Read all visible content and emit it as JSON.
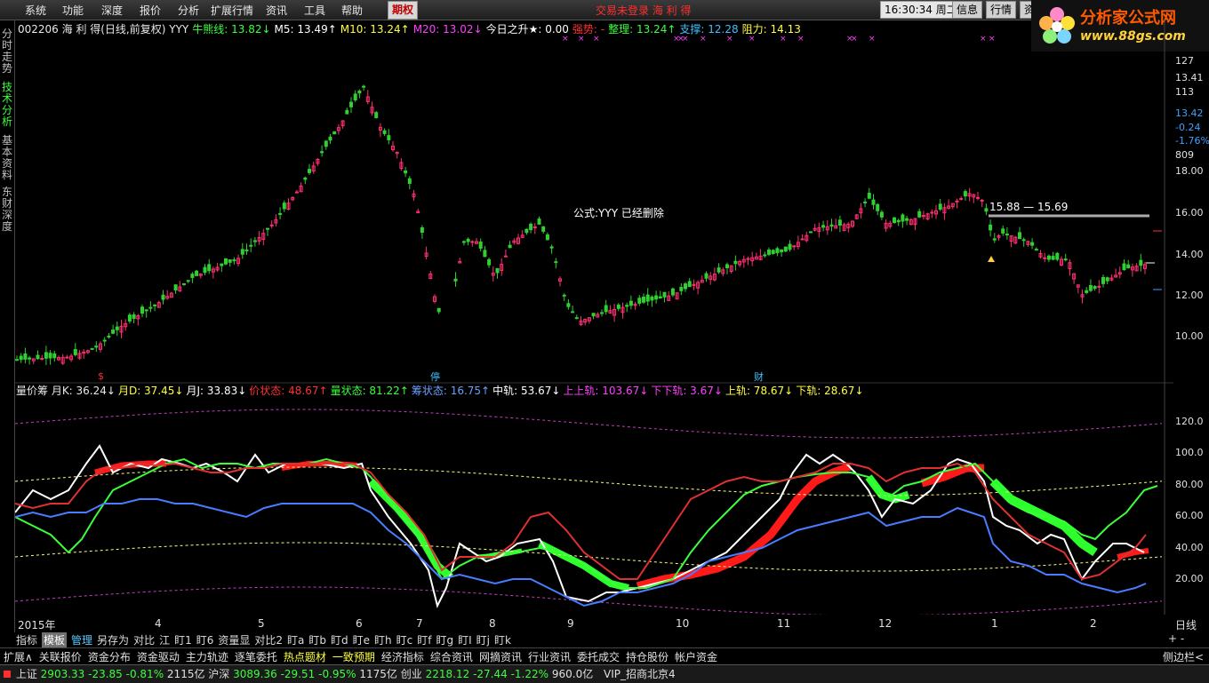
{
  "menu": {
    "items": [
      "系统",
      "功能",
      "深度",
      "报价",
      "分析",
      "扩展行情",
      "资讯",
      "工具",
      "帮助",
      "期权"
    ],
    "status_center": "交易未登录  海 利 得",
    "clock": "16:30:34",
    "weekday": "周二",
    "buttons": [
      "信息",
      "行情",
      "资"
    ]
  },
  "logo": {
    "text": "分析家公式网",
    "url": "www.88gs.com"
  },
  "leftnav": [
    "分时走势",
    "技术分析",
    "基本资料",
    "东财深度"
  ],
  "info_line": [
    {
      "t": "002206 海 利 得(日线,前复权) YYY",
      "c": "#e8e8e8"
    },
    {
      "t": "牛熊线: 13.82↓",
      "c": "#3cff3c"
    },
    {
      "t": "M5: 13.49↑",
      "c": "#ffffff"
    },
    {
      "t": "M10: 13.24↑",
      "c": "#ffff40"
    },
    {
      "t": "M20: 13.02↓",
      "c": "#ff40ff"
    },
    {
      "t": "今日之升★: 0.00",
      "c": "#ffffff"
    },
    {
      "t": "强势: -",
      "c": "#ff3030"
    },
    {
      "t": "整理: 13.24↑",
      "c": "#3cff3c"
    },
    {
      "t": "支撑: 12.28",
      "c": "#40c0ff"
    },
    {
      "t": "阻力: 14.13",
      "c": "#ffff40"
    }
  ],
  "deleted_msg": "公式:YYY 已经删除",
  "range_label": "15.88 — 15.69",
  "markers": {
    "s": "$",
    "ting": "停",
    "cai": "财"
  },
  "price_axis": {
    "labels": [
      "127",
      "13.41",
      "113",
      "13.42",
      "-0.24",
      "-1.76%",
      "809",
      "18.00",
      "16.00",
      "14.00",
      "12.00",
      "10.00"
    ],
    "colors": [
      "#e0e0e0",
      "#e0e0e0",
      "#e0e0e0",
      "#40a0ff",
      "#40a0ff",
      "#40a0ff",
      "#e0e0e0",
      "#e0e0e0",
      "#e0e0e0",
      "#e0e0e0",
      "#e0e0e0",
      "#e0e0e0"
    ]
  },
  "ind_axis": {
    "labels": [
      "120.0",
      "100.0",
      "80.00",
      "60.00",
      "40.00",
      "20.00"
    ]
  },
  "ind_line": [
    {
      "t": "量价筹 月K: 36.24↓",
      "c": "#e8e8e8"
    },
    {
      "t": "月D: 37.45↓",
      "c": "#ffff40"
    },
    {
      "t": "月J: 33.83↓",
      "c": "#ffffff"
    },
    {
      "t": "价状态: 48.67↑",
      "c": "#ff3030"
    },
    {
      "t": "量状态: 81.22↑",
      "c": "#3cff3c"
    },
    {
      "t": "筹状态: 16.75↑",
      "c": "#6aa0ff"
    },
    {
      "t": "中轨: 53.67↓",
      "c": "#ffffff"
    },
    {
      "t": "上上轨: 103.67↓",
      "c": "#ff40ff"
    },
    {
      "t": "下下轨: 3.67↓",
      "c": "#ff40ff"
    },
    {
      "t": "上轨: 78.67↓",
      "c": "#ffff40"
    },
    {
      "t": "下轨: 28.67↓",
      "c": "#ffff40"
    }
  ],
  "x_axis": [
    "2015年",
    "4",
    "5",
    "6",
    "7",
    "8",
    "9",
    "10",
    "11",
    "12",
    "1",
    "2"
  ],
  "x_axis_unit": "日线",
  "tabs": [
    "指标",
    "模板",
    "管理",
    "另存为",
    "对比",
    "江",
    "盯1",
    "盯6",
    "资量显",
    "对比2",
    "盯a",
    "盯b",
    "盯d",
    "盯e",
    "盯h",
    "盯c",
    "盯f",
    "盯g",
    "盯I",
    "盯j",
    "盯k"
  ],
  "func_buttons": [
    "扩展∧",
    "关联报价",
    "资金分布",
    "资金驱动",
    "主力轨迹",
    "逐笔委托",
    "热点题材",
    "一致预期",
    "经济指标",
    "综合资讯",
    "网摘资讯",
    "行业资讯",
    "委托成交",
    "持仓股份",
    "帐户资金"
  ],
  "func_right": "侧边栏<",
  "ticker": {
    "sh_name": "上证",
    "sh_val": "2903.33",
    "sh_chg": "-23.85",
    "sh_pct": "-0.81%",
    "sh_amt": "2115亿",
    "hs_name": "沪深",
    "hs_val": "3089.36",
    "hs_chg": "-29.51",
    "hs_pct": "-0.95%",
    "hs_amt": "1175亿",
    "cy_name": "创业",
    "cy_val": "2218.12",
    "cy_chg": "-27.44",
    "cy_pct": "-1.22%",
    "cy_amt": "960.0亿",
    "vip": "VIP_招商北京4"
  }
}
